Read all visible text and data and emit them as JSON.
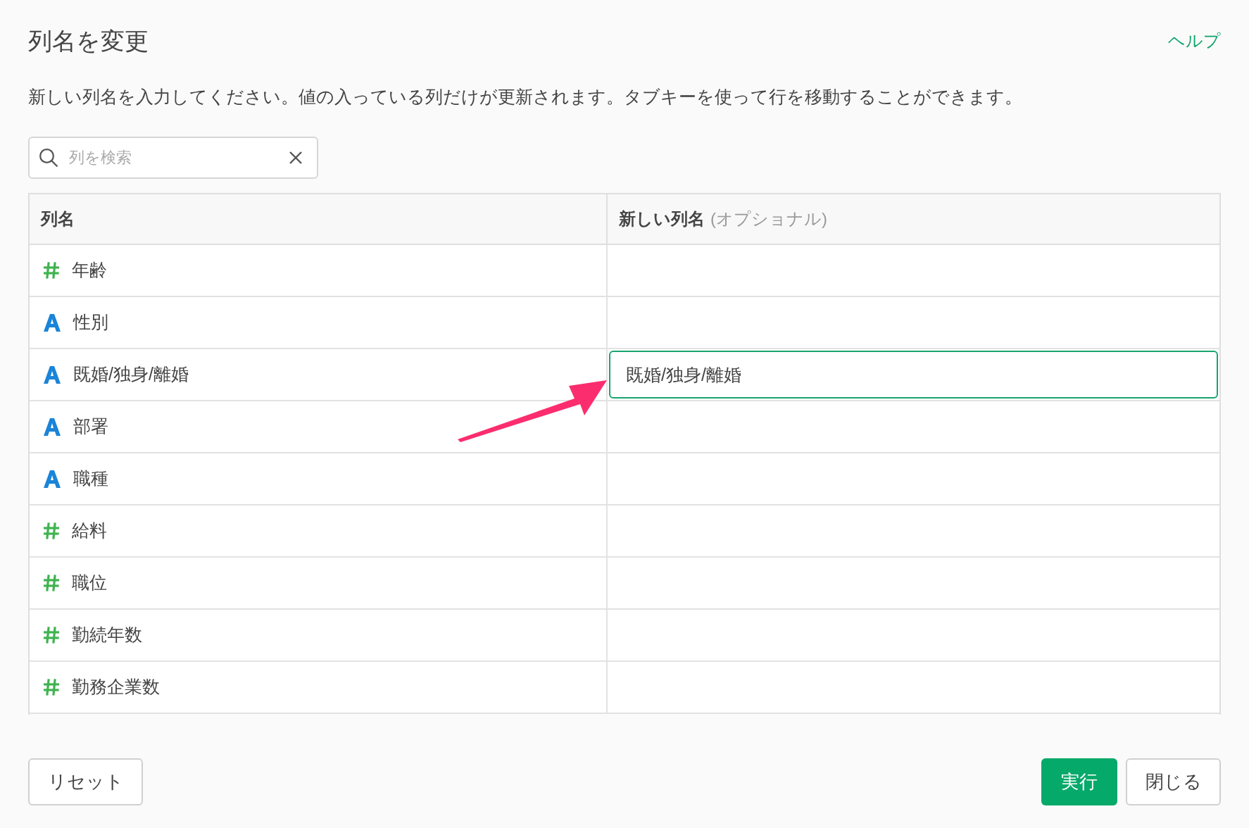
{
  "title": "列名を変更",
  "help_link": "ヘルプ",
  "description": "新しい列名を入力してください。値の入っている列だけが更新されます。タブキーを使って行を移動することができます。",
  "search": {
    "placeholder": "列を検索"
  },
  "table": {
    "columns": [
      {
        "label": "列名"
      },
      {
        "label": "新しい列名",
        "note": "(オプショナル)"
      }
    ],
    "rows": [
      {
        "kind": "number",
        "name": "年齢",
        "new_name": "",
        "focused": false
      },
      {
        "kind": "string",
        "name": "性別",
        "new_name": "",
        "focused": false
      },
      {
        "kind": "string",
        "name": "既婚/独身/離婚",
        "new_name": "既婚/独身/離婚",
        "focused": true
      },
      {
        "kind": "string",
        "name": "部署",
        "new_name": "",
        "focused": false
      },
      {
        "kind": "string",
        "name": "職種",
        "new_name": "",
        "focused": false
      },
      {
        "kind": "number",
        "name": "給料",
        "new_name": "",
        "focused": false
      },
      {
        "kind": "number",
        "name": "職位",
        "new_name": "",
        "focused": false
      },
      {
        "kind": "number",
        "name": "勤続年数",
        "new_name": "",
        "focused": false
      },
      {
        "kind": "number",
        "name": "勤務企業数",
        "new_name": "",
        "focused": false
      }
    ]
  },
  "buttons": {
    "reset": "リセット",
    "run": "実行",
    "close": "閉じる"
  }
}
